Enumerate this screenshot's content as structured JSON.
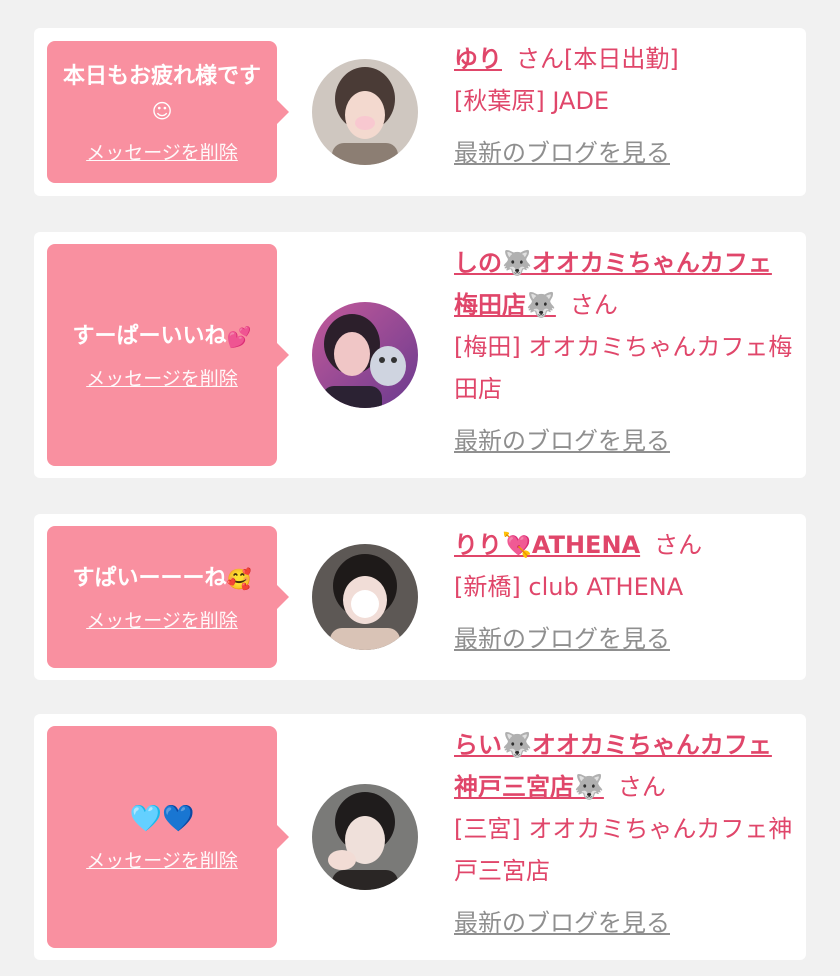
{
  "messages": [
    {
      "bubble_text": "本日もお疲れ様です",
      "bubble_emoji": "☺",
      "delete_label": "メッセージを削除",
      "name": "ゆり",
      "san": "さん",
      "status": "[本日出勤]",
      "area": "[秋葉原]",
      "shop": "JADE",
      "blog_label": "最新のブログを見る"
    },
    {
      "bubble_text": "すーぱーいいね",
      "bubble_emoji": "💕",
      "delete_label": "メッセージを削除",
      "name": "しの🐺オオカミちゃんカフェ梅田店🐺",
      "san": "さん",
      "area": "[梅田]",
      "shop": "オオカミちゃんカフェ梅田店",
      "blog_label": "最新のブログを見る"
    },
    {
      "bubble_text": "すぱいーーーね",
      "bubble_emoji": "🥰",
      "delete_label": "メッセージを削除",
      "name": "りり💘ATHENA",
      "san": "さん",
      "area": "[新橋]",
      "shop": "club ATHENA",
      "blog_label": "最新のブログを見る"
    },
    {
      "bubble_text": "🩵💙",
      "delete_label": "メッセージを削除",
      "name": "らい🐺オオカミちゃんカフェ神戸三宮店🐺",
      "san": "さん",
      "area": "[三宮]",
      "shop": "オオカミちゃんカフェ神戸三宮店",
      "blog_label": "最新のブログを見る"
    }
  ],
  "colors": {
    "accent": "#e0466a",
    "bubble": "#f990a0",
    "link_gray": "#8f8f8f",
    "background": "#f1f1f1"
  }
}
